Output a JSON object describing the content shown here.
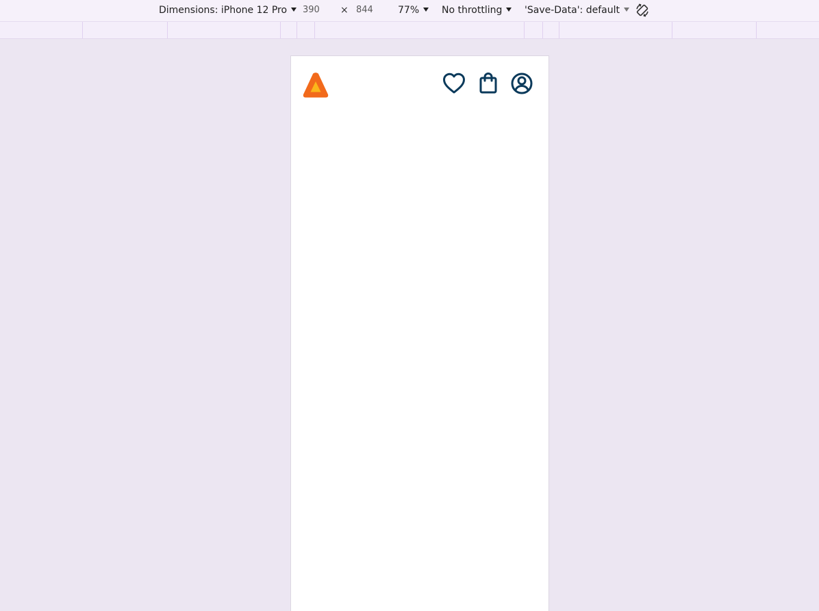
{
  "device_toolbar": {
    "dimensions_label": "Dimensions: iPhone 12 Pro",
    "width_value": "390",
    "times_symbol": "×",
    "height_value": "844",
    "zoom_label": "77%",
    "throttling_label": "No throttling",
    "save_data_label": "'Save-Data': default",
    "rotate_icon": "rotate-icon"
  },
  "app_header": {
    "logo_icon": "triangle-logo-icon",
    "icons": [
      "heart-icon",
      "shopping-bag-icon",
      "user-circle-icon"
    ]
  },
  "colors": {
    "logo_orange": "#f26a1b",
    "logo_yellow": "#fbb61b",
    "icon_navy": "#0b3a5b",
    "devtools_bg": "#ece6f2"
  }
}
